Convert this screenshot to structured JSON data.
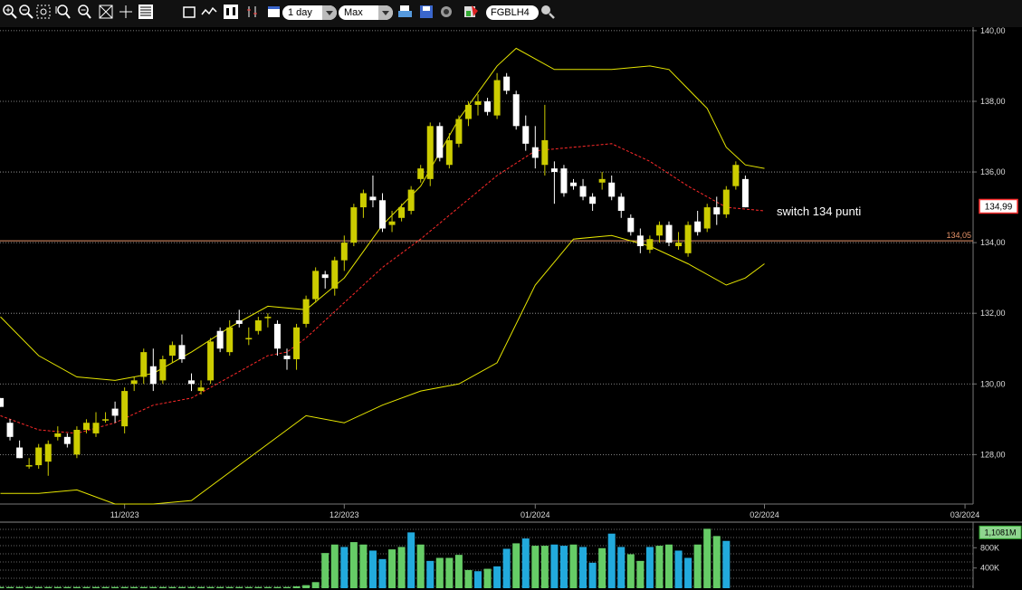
{
  "toolbar": {
    "interval": "1 day",
    "range": "Max",
    "symbol": "FGBLH4",
    "icons": [
      "zoom-in-icon",
      "zoom-out-icon",
      "zoom-fit-icon",
      "zoom-x-in-icon",
      "zoom-x-out-icon",
      "zoom-reset-icon",
      "crosshair-icon",
      "bar-chart-icon",
      "box-icon",
      "line-icon",
      "candlestick-icon",
      "indicators-icon",
      "calendar-icon",
      "print-icon",
      "save-icon",
      "refresh-icon",
      "color-icon",
      "search-icon"
    ]
  },
  "colors": {
    "bull": "#cccc00",
    "bear": "#ffffff",
    "band": "#e6e600",
    "mid": "#ff2a2a",
    "level": "#e8946a",
    "grid": "#aaaaaa",
    "vol_green": "#66cc66",
    "vol_blue": "#22aadd",
    "price_label_border": "#ff3030"
  },
  "chart_data": {
    "type": "candlestick",
    "symbol": "FGBLH4",
    "interval": "1 day",
    "price_axis": {
      "ticks": [
        "140,00",
        "138,00",
        "136,00",
        "134,00",
        "132,00",
        "130,00",
        "128,00"
      ],
      "ylim": [
        126.6,
        140.1
      ]
    },
    "time_axis": {
      "ticks": [
        "11/2023",
        "12/2023",
        "01/2024",
        "02/2024",
        "03/2024"
      ]
    },
    "last_price": "134,99",
    "level_label": "134,05",
    "level": 134.05,
    "annotation": "switch 134 punti",
    "candles": [
      [
        129.6,
        129.6,
        129.35,
        129.35
      ],
      [
        128.9,
        129.0,
        128.4,
        128.5
      ],
      [
        128.2,
        128.4,
        127.9,
        127.9
      ],
      [
        127.7,
        127.9,
        127.6,
        127.7
      ],
      [
        127.7,
        128.3,
        127.6,
        128.2
      ],
      [
        127.8,
        128.4,
        127.4,
        128.3
      ],
      [
        128.5,
        128.8,
        128.4,
        128.6
      ],
      [
        128.5,
        128.6,
        128.2,
        128.3
      ],
      [
        128.0,
        128.8,
        127.9,
        128.7
      ],
      [
        128.7,
        129.0,
        128.6,
        128.9
      ],
      [
        128.6,
        129.2,
        128.5,
        128.9
      ],
      [
        129.0,
        129.2,
        128.9,
        129.0
      ],
      [
        129.3,
        129.5,
        128.9,
        129.1
      ],
      [
        128.8,
        129.9,
        128.6,
        129.8
      ],
      [
        130.0,
        130.2,
        129.8,
        130.1
      ],
      [
        130.2,
        131.0,
        130.0,
        130.9
      ],
      [
        130.5,
        131.0,
        129.8,
        130.0
      ],
      [
        130.1,
        130.8,
        130.0,
        130.7
      ],
      [
        130.8,
        131.2,
        130.6,
        131.1
      ],
      [
        131.1,
        131.4,
        130.6,
        130.7
      ],
      [
        130.1,
        130.3,
        129.8,
        130.0
      ],
      [
        129.8,
        130.1,
        129.7,
        129.9
      ],
      [
        130.1,
        131.3,
        130.0,
        131.2
      ],
      [
        131.5,
        131.6,
        130.9,
        131.0
      ],
      [
        130.9,
        131.8,
        130.8,
        131.6
      ],
      [
        131.8,
        132.1,
        131.6,
        131.7
      ],
      [
        131.3,
        131.6,
        131.1,
        131.3
      ],
      [
        131.5,
        131.9,
        131.4,
        131.8
      ],
      [
        131.9,
        132.0,
        131.6,
        131.9
      ],
      [
        131.7,
        131.8,
        130.8,
        131.0
      ],
      [
        130.8,
        131.0,
        130.4,
        130.7
      ],
      [
        130.7,
        131.7,
        130.4,
        131.6
      ],
      [
        131.7,
        132.5,
        131.6,
        132.4
      ],
      [
        132.4,
        133.3,
        132.3,
        133.2
      ],
      [
        133.1,
        133.2,
        132.7,
        133.0
      ],
      [
        132.7,
        133.6,
        132.5,
        133.5
      ],
      [
        133.5,
        134.2,
        133.2,
        134.0
      ],
      [
        134.0,
        135.1,
        133.9,
        135.0
      ],
      [
        135.0,
        135.5,
        134.7,
        135.4
      ],
      [
        135.3,
        135.9,
        135.0,
        135.2
      ],
      [
        135.2,
        135.4,
        134.3,
        134.4
      ],
      [
        134.5,
        134.9,
        134.3,
        134.6
      ],
      [
        134.7,
        135.1,
        134.6,
        135.0
      ],
      [
        134.9,
        135.6,
        134.8,
        135.5
      ],
      [
        135.8,
        136.2,
        135.7,
        136.1
      ],
      [
        135.8,
        137.4,
        135.6,
        137.3
      ],
      [
        137.3,
        137.4,
        136.3,
        136.4
      ],
      [
        136.2,
        137.1,
        136.1,
        136.9
      ],
      [
        136.8,
        137.6,
        136.7,
        137.5
      ],
      [
        137.5,
        138.0,
        137.3,
        137.9
      ],
      [
        137.9,
        138.2,
        137.6,
        138.0
      ],
      [
        138.0,
        138.1,
        137.6,
        137.7
      ],
      [
        137.6,
        138.8,
        137.5,
        138.6
      ],
      [
        138.7,
        138.8,
        138.2,
        138.3
      ],
      [
        138.2,
        138.3,
        137.2,
        137.3
      ],
      [
        137.3,
        137.6,
        136.6,
        136.8
      ],
      [
        136.7,
        137.3,
        136.1,
        136.4
      ],
      [
        136.2,
        137.9,
        135.9,
        136.9
      ],
      [
        136.1,
        136.3,
        135.1,
        136.0
      ],
      [
        136.1,
        136.2,
        135.3,
        135.4
      ],
      [
        135.7,
        135.8,
        135.5,
        135.6
      ],
      [
        135.6,
        135.8,
        135.2,
        135.3
      ],
      [
        135.3,
        135.4,
        134.9,
        135.1
      ],
      [
        135.7,
        136.0,
        135.5,
        135.8
      ],
      [
        135.7,
        135.9,
        135.2,
        135.3
      ],
      [
        135.3,
        135.4,
        134.7,
        134.9
      ],
      [
        134.7,
        134.8,
        134.2,
        134.3
      ],
      [
        134.2,
        134.4,
        133.7,
        133.9
      ],
      [
        133.8,
        134.2,
        133.7,
        134.1
      ],
      [
        134.2,
        134.6,
        134.0,
        134.5
      ],
      [
        134.5,
        134.6,
        133.9,
        134.0
      ],
      [
        133.9,
        134.3,
        133.8,
        134.0
      ],
      [
        133.7,
        134.6,
        133.6,
        134.5
      ],
      [
        134.6,
        134.9,
        134.2,
        134.3
      ],
      [
        134.4,
        135.1,
        134.3,
        135.0
      ],
      [
        135.0,
        135.3,
        134.5,
        134.8
      ],
      [
        134.8,
        135.6,
        134.7,
        135.5
      ],
      [
        135.6,
        136.3,
        135.5,
        136.2
      ],
      [
        135.8,
        135.9,
        135.0,
        135.0
      ]
    ],
    "bollinger_upper": [
      [
        0,
        131.9
      ],
      [
        4,
        130.8
      ],
      [
        8,
        130.2
      ],
      [
        12,
        130.1
      ],
      [
        16,
        130.3
      ],
      [
        20,
        130.9
      ],
      [
        24,
        131.6
      ],
      [
        28,
        132.2
      ],
      [
        32,
        132.1
      ],
      [
        36,
        133.0
      ],
      [
        40,
        134.5
      ],
      [
        44,
        135.6
      ],
      [
        48,
        137.5
      ],
      [
        52,
        139.0
      ],
      [
        54,
        139.5
      ],
      [
        58,
        138.9
      ],
      [
        64,
        138.9
      ],
      [
        68,
        139.0
      ],
      [
        70,
        138.9
      ],
      [
        74,
        137.8
      ],
      [
        76,
        136.7
      ],
      [
        78,
        136.2
      ],
      [
        80,
        136.1
      ]
    ],
    "bollinger_mid": [
      [
        0,
        129.1
      ],
      [
        4,
        128.7
      ],
      [
        8,
        128.6
      ],
      [
        12,
        128.9
      ],
      [
        16,
        129.4
      ],
      [
        20,
        129.6
      ],
      [
        24,
        130.2
      ],
      [
        28,
        130.8
      ],
      [
        30,
        130.9
      ],
      [
        32,
        131.3
      ],
      [
        36,
        132.3
      ],
      [
        40,
        133.3
      ],
      [
        44,
        134.1
      ],
      [
        48,
        135.0
      ],
      [
        52,
        135.9
      ],
      [
        56,
        136.6
      ],
      [
        60,
        136.7
      ],
      [
        64,
        136.8
      ],
      [
        68,
        136.3
      ],
      [
        72,
        135.6
      ],
      [
        76,
        135.0
      ],
      [
        80,
        134.9
      ]
    ],
    "bollinger_lower": [
      [
        0,
        126.9
      ],
      [
        4,
        126.9
      ],
      [
        8,
        127.0
      ],
      [
        12,
        126.6
      ],
      [
        16,
        126.6
      ],
      [
        20,
        126.7
      ],
      [
        24,
        127.5
      ],
      [
        28,
        128.3
      ],
      [
        32,
        129.1
      ],
      [
        36,
        128.9
      ],
      [
        40,
        129.4
      ],
      [
        44,
        129.8
      ],
      [
        48,
        130.0
      ],
      [
        52,
        130.6
      ],
      [
        56,
        132.8
      ],
      [
        60,
        134.1
      ],
      [
        64,
        134.2
      ],
      [
        68,
        133.9
      ],
      [
        72,
        133.4
      ],
      [
        76,
        132.8
      ],
      [
        78,
        133.0
      ],
      [
        80,
        133.4
      ]
    ],
    "volume_axis": {
      "ticks": [
        "800K",
        "400K"
      ],
      "last": "1,1081M",
      "max": 1200000
    },
    "volume": [
      [
        0.02,
        "g"
      ],
      [
        0.02,
        "g"
      ],
      [
        0.02,
        "g"
      ],
      [
        0.02,
        "g"
      ],
      [
        0.02,
        "g"
      ],
      [
        0.02,
        "g"
      ],
      [
        0.02,
        "g"
      ],
      [
        0.02,
        "g"
      ],
      [
        0.02,
        "g"
      ],
      [
        0.02,
        "g"
      ],
      [
        0.02,
        "g"
      ],
      [
        0.02,
        "g"
      ],
      [
        0.02,
        "g"
      ],
      [
        0.02,
        "g"
      ],
      [
        0.02,
        "g"
      ],
      [
        0.02,
        "g"
      ],
      [
        0.02,
        "g"
      ],
      [
        0.02,
        "g"
      ],
      [
        0.02,
        "g"
      ],
      [
        0.02,
        "g"
      ],
      [
        0.02,
        "g"
      ],
      [
        0.02,
        "g"
      ],
      [
        0.02,
        "g"
      ],
      [
        0.02,
        "g"
      ],
      [
        0.02,
        "g"
      ],
      [
        0.02,
        "g"
      ],
      [
        0.02,
        "g"
      ],
      [
        0.02,
        "g"
      ],
      [
        0.02,
        "g"
      ],
      [
        0.02,
        "g"
      ],
      [
        0.02,
        "g"
      ],
      [
        0.03,
        "g"
      ],
      [
        0.05,
        "g"
      ],
      [
        0.1,
        "g"
      ],
      [
        0.58,
        "g"
      ],
      [
        0.72,
        "g"
      ],
      [
        0.68,
        "b"
      ],
      [
        0.76,
        "g"
      ],
      [
        0.72,
        "g"
      ],
      [
        0.62,
        "b"
      ],
      [
        0.48,
        "b"
      ],
      [
        0.64,
        "g"
      ],
      [
        0.68,
        "g"
      ],
      [
        0.92,
        "b"
      ],
      [
        0.72,
        "g"
      ],
      [
        0.45,
        "b"
      ],
      [
        0.5,
        "g"
      ],
      [
        0.5,
        "g"
      ],
      [
        0.55,
        "g"
      ],
      [
        0.3,
        "g"
      ],
      [
        0.28,
        "b"
      ],
      [
        0.32,
        "g"
      ],
      [
        0.36,
        "b"
      ],
      [
        0.65,
        "b"
      ],
      [
        0.74,
        "g"
      ],
      [
        0.82,
        "b"
      ],
      [
        0.7,
        "g"
      ],
      [
        0.7,
        "g"
      ],
      [
        0.72,
        "b"
      ],
      [
        0.7,
        "b"
      ],
      [
        0.72,
        "g"
      ],
      [
        0.68,
        "b"
      ],
      [
        0.42,
        "b"
      ],
      [
        0.66,
        "g"
      ],
      [
        0.9,
        "b"
      ],
      [
        0.68,
        "b"
      ],
      [
        0.56,
        "g"
      ],
      [
        0.45,
        "g"
      ],
      [
        0.68,
        "b"
      ],
      [
        0.7,
        "g"
      ],
      [
        0.72,
        "g"
      ],
      [
        0.62,
        "b"
      ],
      [
        0.5,
        "b"
      ],
      [
        0.72,
        "g"
      ],
      [
        0.98,
        "g"
      ],
      [
        0.86,
        "g"
      ],
      [
        0.78,
        "b"
      ]
    ]
  }
}
